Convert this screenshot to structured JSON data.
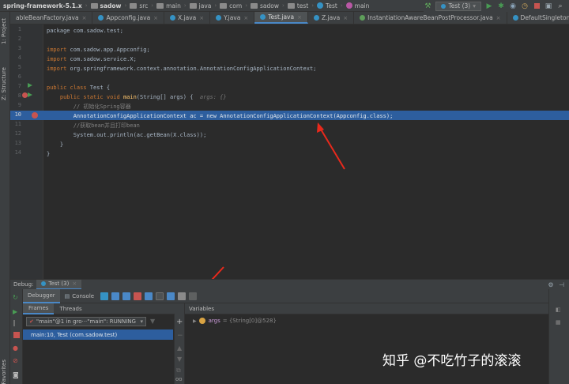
{
  "navbar": {
    "crumbs": [
      "spring-framework-5.1.x",
      "sadow",
      "src",
      "main",
      "java",
      "com",
      "sadow",
      "test",
      "Test",
      "main"
    ]
  },
  "toolbar": {
    "run_config": "Test (3)"
  },
  "tabs": [
    "ableBeanFactory.java",
    "Appconfig.java",
    "X.java",
    "Y.java",
    "Test.java",
    "Z.java",
    "InstantiationAwareBeanPostProcessor.java",
    "DefaultSingletonBeanRegistry.java"
  ],
  "left_strip": {
    "project": "1: Project",
    "structure": "Z: Structure",
    "favorites": "Favorites"
  },
  "editor": {
    "line_numbers": [
      "1",
      "2",
      "3",
      "4",
      "5",
      "6",
      "7",
      "8",
      "9",
      "10",
      "11",
      "12",
      "13",
      "14"
    ],
    "package_line": "package com.sadow.test;",
    "import1": "com.sadow.app.Appconfig;",
    "import2": "com.sadow.service.X;",
    "import3": "org.springframework.context.annotation.AnnotationConfigApplicationContext;",
    "class_decl": "Test {",
    "main_sig": "(String[] args) {",
    "main_hint": "args: {}",
    "comment1": "// 初始化Spring容器",
    "line10": "AnnotationConfigApplicationContext ac = new AnnotationConfigApplicationContext(Appconfig.class);",
    "comment2": "//获取bean并且打印bean",
    "line12": "System.out.println(ac.getBean(X.class));",
    "brace_close_method": "}",
    "brace_close_class": "}"
  },
  "debug": {
    "title": "Debug:",
    "config_tab": "Test (3)",
    "tab_debugger": "Debugger",
    "tab_console": "Console",
    "frames_tab": "Frames",
    "threads_tab": "Threads",
    "thread_selected": "\"main\"@1 in gro···\"main\": RUNNING",
    "frame": "main:10, Test (com.sadow.test)",
    "variables_label": "Variables",
    "var_name": "args",
    "var_value": "= {String[0]@528}"
  },
  "watermark": "知乎 @不吃竹子的滚滚",
  "colors": {
    "exec_line": "#2d5e9e",
    "breakpoint": "#c75450",
    "arrow": "#e8291c"
  }
}
